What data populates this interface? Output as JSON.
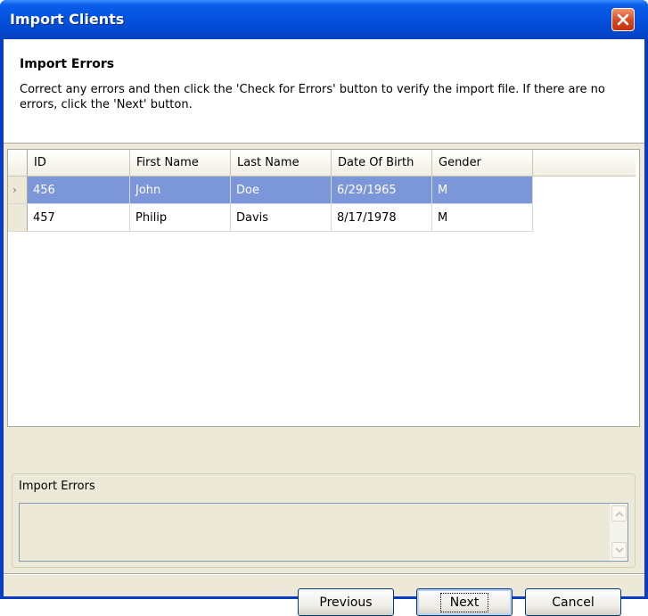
{
  "window": {
    "title": "Import Clients"
  },
  "header": {
    "title": "Import Errors",
    "description": "Correct any errors and then click the 'Check for Errors' button to verify the import file. If there are no errors, click the 'Next' button."
  },
  "grid": {
    "columns": [
      "ID",
      "First Name",
      "Last Name",
      "Date Of Birth",
      "Gender"
    ],
    "rows": [
      {
        "id": "456",
        "first_name": "John",
        "last_name": "Doe",
        "dob": "6/29/1965",
        "gender": "M",
        "selected": true
      },
      {
        "id": "457",
        "first_name": "Philip",
        "last_name": "Davis",
        "dob": "8/17/1978",
        "gender": "M",
        "selected": false
      }
    ]
  },
  "errors_group": {
    "label": "Import Errors",
    "value": ""
  },
  "buttons": {
    "previous": "Previous",
    "next": "Next",
    "cancel": "Cancel"
  },
  "colors": {
    "selection": "#7b96d9",
    "title_bar": "#0554e3",
    "close_button": "#d8461d"
  }
}
